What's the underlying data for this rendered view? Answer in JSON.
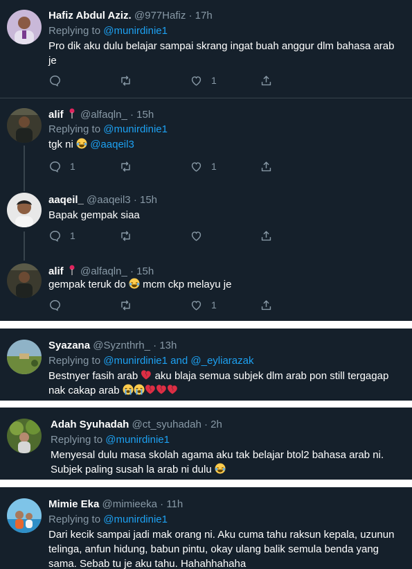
{
  "tweets": [
    {
      "name": "Hafiz Abdul Aziz.",
      "handle": "@977Hafiz",
      "sep": "·",
      "time": "17h",
      "replying_prefix": "Replying to",
      "replying_to": "@munirdinie1",
      "text_line1": "Pro dik aku dulu belajar sampai skrang ingat buah anggur dlm bahasa arab",
      "text_line2": "je",
      "counts": {
        "reply": "",
        "retweet": "",
        "like": "1"
      }
    },
    {
      "name": "alif",
      "handle": "@alfaqln_",
      "sep": "·",
      "time": "15h",
      "replying_prefix": "Replying to",
      "replying_to": "@munirdinie1",
      "text_before": "tgk ni",
      "mention": "@aaqeil3",
      "counts": {
        "reply": "1",
        "retweet": "",
        "like": "1"
      }
    },
    {
      "name": "aaqeil_",
      "handle": "@aaqeil3",
      "sep": "·",
      "time": "15h",
      "text_line1": "Bapak gempak siaa",
      "counts": {
        "reply": "1",
        "retweet": "",
        "like": ""
      }
    },
    {
      "name": "alif",
      "handle": "@alfaqln_",
      "sep": "·",
      "time": "15h",
      "text_before": "gempak teruk do",
      "text_after": "mcm ckp melayu je",
      "counts": {
        "reply": "",
        "retweet": "",
        "like": "1"
      }
    },
    {
      "name": "Syazana",
      "handle": "@Syznthrh_",
      "sep": "·",
      "time": "13h",
      "replying_prefix": "Replying to",
      "replying_to": "@munirdinie1",
      "replying_and": "and",
      "replying_to2": "@_eyliarazak",
      "text_before": "Bestnyer fasih arab",
      "text_after": "aku blaja semua subjek dlm arab pon still tergagap",
      "text_line2": "nak cakap arab"
    },
    {
      "name": "Adah Syuhadah",
      "handle": "@ct_syuhadah",
      "sep": "·",
      "time": "2h",
      "replying_prefix": "Replying to",
      "replying_to": "@munirdinie1",
      "text_line1": "Menyesal dulu masa skolah agama aku tak belajar btol2 bahasa arab ni.",
      "text_line2": "Subjek paling susah la arab ni dulu"
    },
    {
      "name": "Mimie Eka",
      "handle": "@mimieeka",
      "sep": "·",
      "time": "11h",
      "replying_prefix": "Replying to",
      "replying_to": "@munirdinie1",
      "text_line1": "Dari kecik sampai jadi mak orang ni. Aku cuma tahu raksun kepala, uzunun",
      "text_line2": "telinga, anfun hidung, babun pintu, okay ulang balik semula benda yang",
      "text_line3": "sama. Sebab tu je aku tahu. Hahahhahaha"
    }
  ],
  "colors": {
    "background": "#15202b",
    "name": "#ffffff",
    "meta": "#8899a6",
    "link": "#1da1f2",
    "divider": "#38444d"
  },
  "icons": [
    "reply-icon",
    "retweet-icon",
    "like-icon",
    "share-icon",
    "pin-flag-icon",
    "laughing-crying-emoji",
    "broken-heart-emoji",
    "loudly-crying-emoji"
  ]
}
